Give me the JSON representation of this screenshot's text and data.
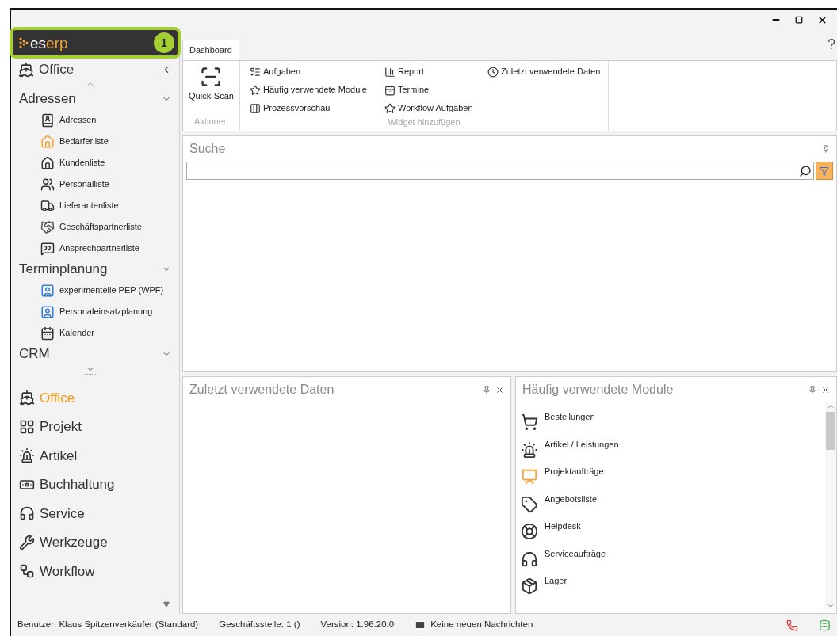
{
  "window": {
    "help": "?"
  },
  "sidebar": {
    "logo": {
      "parts": [
        {
          "text": "es",
          "color": "#ffffff"
        },
        {
          "text": "erp",
          "color": "#f5a23a"
        }
      ],
      "badge": "1"
    },
    "header": "Office",
    "groups": [
      {
        "title": "Adressen",
        "items": [
          "Adressen",
          "Bedarferliste",
          "Kundenliste",
          "Personalliste",
          "Lieferantenliste",
          "Geschäftspartnerliste",
          "Ansprechpartnerliste"
        ]
      },
      {
        "title": "Terminplanung",
        "items": [
          "experimentelle PEP (WPF)",
          "Personaleinsatzplanung",
          "Kalender"
        ]
      },
      {
        "title": "CRM"
      }
    ],
    "modules": [
      {
        "label": "Office",
        "selected": true
      },
      {
        "label": "Projekt",
        "selected": false
      },
      {
        "label": "Artikel",
        "selected": false
      },
      {
        "label": "Buchhaltung",
        "selected": false
      },
      {
        "label": "Service",
        "selected": false
      },
      {
        "label": "Werkzeuge",
        "selected": false
      },
      {
        "label": "Workflow",
        "selected": false
      }
    ]
  },
  "ribbon": {
    "tabs": [
      {
        "label": "Dashboard",
        "selected": true
      }
    ],
    "actions": {
      "title": "Aktionen",
      "button": "Quick-Scan"
    },
    "widgets": {
      "title": "Widget hinzufügen",
      "columns": [
        [
          "Aufgaben",
          "Häufig verwendete Module",
          "Prozessvorschau"
        ],
        [
          "Report",
          "Termine",
          "Workflow Aufgaben"
        ],
        [
          "Zuletzt verwendete Daten"
        ]
      ]
    }
  },
  "search_panel": {
    "title": "Suche"
  },
  "recent_panel": {
    "title": "Zuletzt verwendete Daten"
  },
  "modules_panel": {
    "title": "Häufig verwendete Module",
    "items": [
      "Bestellungen",
      "Artikel / Leistungen",
      "Projektaufträge",
      "Angebotsliste",
      "Helpdesk",
      "Serviceaufträge",
      "Lager"
    ]
  },
  "status_bar": {
    "user": "Benutzer: Klaus Spitzenverkäufer (Standard)",
    "branch": "Geschäftsstelle: 1 ()",
    "version": "Version: 1.96.20.0",
    "messages": "Keine neuen Nachrichten"
  }
}
